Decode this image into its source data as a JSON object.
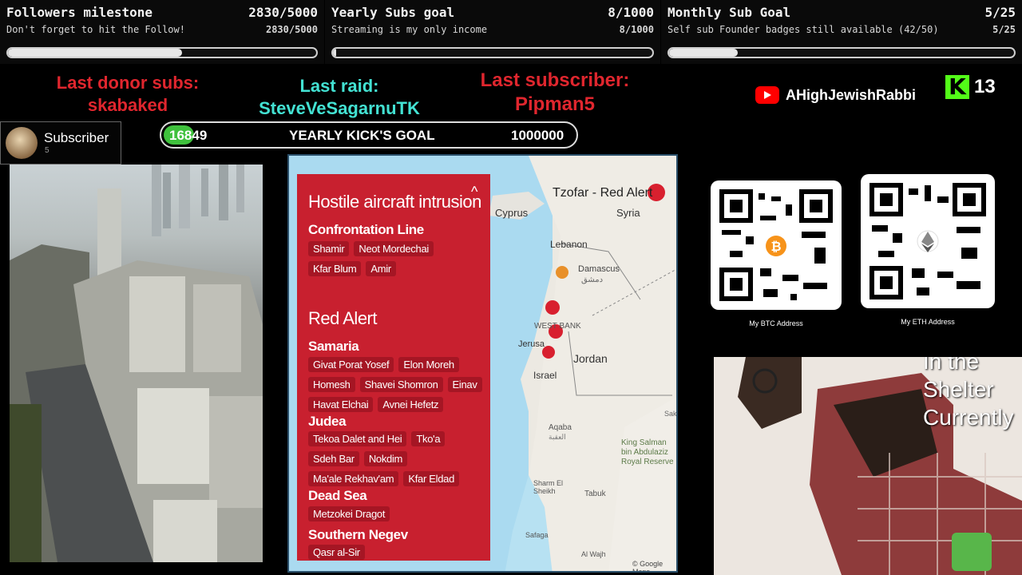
{
  "goals": [
    {
      "title": "Followers milestone",
      "count": "2830/5000",
      "subtitle": "Don't forget to hit the Follow!",
      "count2": "2830/5000",
      "progress": 0.566
    },
    {
      "title": "Yearly Subs goal",
      "count": "8/1000",
      "subtitle": "Streaming is my only income",
      "count2": "8/1000",
      "progress": 0.008
    },
    {
      "title": "Monthly Sub Goal",
      "count": "5/25",
      "subtitle": "Self sub Founder badges still available (42/50)",
      "count2": "5/25",
      "progress": 0.2
    }
  ],
  "labels": {
    "donor_title": "Last donor subs:",
    "donor_name": "skabaked",
    "raid_title": "Last raid:",
    "raid_name": "SteveVeSagarnuTK",
    "sub_title": "Last subscriber:",
    "sub_name": "Pipman5"
  },
  "subscriber_card": {
    "label": "Subscriber",
    "count": "5"
  },
  "kick_goal": {
    "current": "16849",
    "title": "YEARLY KICK'S GOAL",
    "target": "1000000",
    "progress": 0.0168
  },
  "youtube": {
    "channel": "AHighJewishRabbi",
    "icon": "youtube-icon"
  },
  "kick": {
    "logo": "K",
    "viewers": "13"
  },
  "alert_panel": {
    "title": "Hostile aircraft intrusion",
    "section1": "Confrontation Line",
    "section1_places": [
      "Shamir",
      "Neot Mordechai",
      "Kfar Blum",
      "Amir"
    ],
    "title2": "Red Alert",
    "groups": [
      {
        "name": "Samaria",
        "places": [
          "Givat Porat Yosef",
          "Elon Moreh",
          "Homesh",
          "Shavei Shomron",
          "Einav",
          "Havat Elchai",
          "Avnei Hefetz"
        ]
      },
      {
        "name": "Judea",
        "places": [
          "Tekoa Dalet and Hei",
          "Tko'a",
          "Sdeh Bar",
          "Nokdim",
          "Ma'ale Rekhav'am",
          "Kfar Eldad"
        ]
      },
      {
        "name": "Dead Sea",
        "places": [
          "Metzokei Dragot"
        ]
      },
      {
        "name": "Southern Negev",
        "places": [
          "Qasr al-Sir"
        ]
      }
    ]
  },
  "map": {
    "header": "Tzofar - Red Alert",
    "places": {
      "cyprus": "Cyprus",
      "syria": "Syria",
      "lebanon": "Lebanon",
      "damascus": "Damascus",
      "damascus_ar": "دمشق",
      "westbank": "WEST BANK",
      "jerusalem": "Jerusa",
      "israel": "Israel",
      "jordan": "Jordan",
      "aqaba": "Aqaba",
      "aqaba_ar": "العقبة",
      "tabuk": "Tabuk",
      "sharm": "Sharm El Sheikh",
      "safaga": "Safaga",
      "alwajh": "Al Wajh",
      "kingsalman": "King Salman bin Abdulaziz Royal Reserve",
      "sakaka": "Sakak",
      "google": "© Google Maps"
    }
  },
  "qr": {
    "btc_label": "My BTC Address",
    "eth_label": "My ETH Address"
  },
  "cam": {
    "overlay": "In the Shelter Currently"
  }
}
